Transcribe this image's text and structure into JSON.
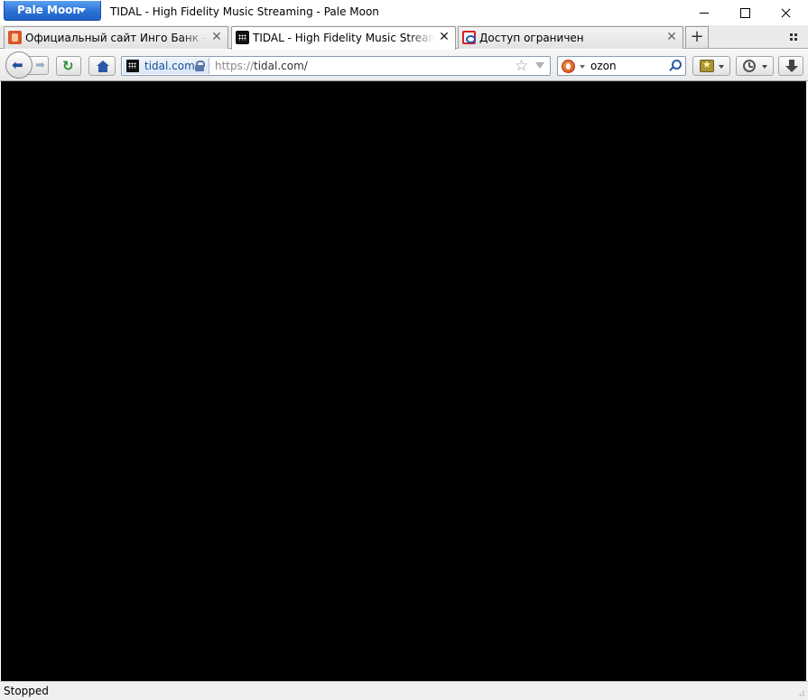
{
  "window": {
    "app_menu_label": "Pale Moon",
    "title": "TIDAL - High Fidelity Music Streaming - Pale Moon"
  },
  "tabs": [
    {
      "label": "Официальный сайт Инго Банк — деб",
      "selected": false,
      "favicon": "ingo-bank-favicon"
    },
    {
      "label": "TIDAL - High Fidelity Music Streaming",
      "selected": true,
      "favicon": "tidal-favicon"
    },
    {
      "label": "Доступ ограничен",
      "selected": false,
      "favicon": "restricted-favicon"
    }
  ],
  "tab_close_glyph": "✕",
  "new_tab_glyph": "+",
  "navbar": {
    "back_glyph": "⬅",
    "forward_glyph": "➡",
    "reload_glyph": "↻",
    "identity_host": "tidal.com",
    "url_scheme": "https://",
    "url_rest": "tidal.com/",
    "star_glyph": "☆",
    "search_value": "ozon"
  },
  "status": {
    "text": "Stopped"
  },
  "colors": {
    "app_button": "#2b72d6",
    "content_background": "#000000",
    "identity_host": "#1d4f9c"
  }
}
